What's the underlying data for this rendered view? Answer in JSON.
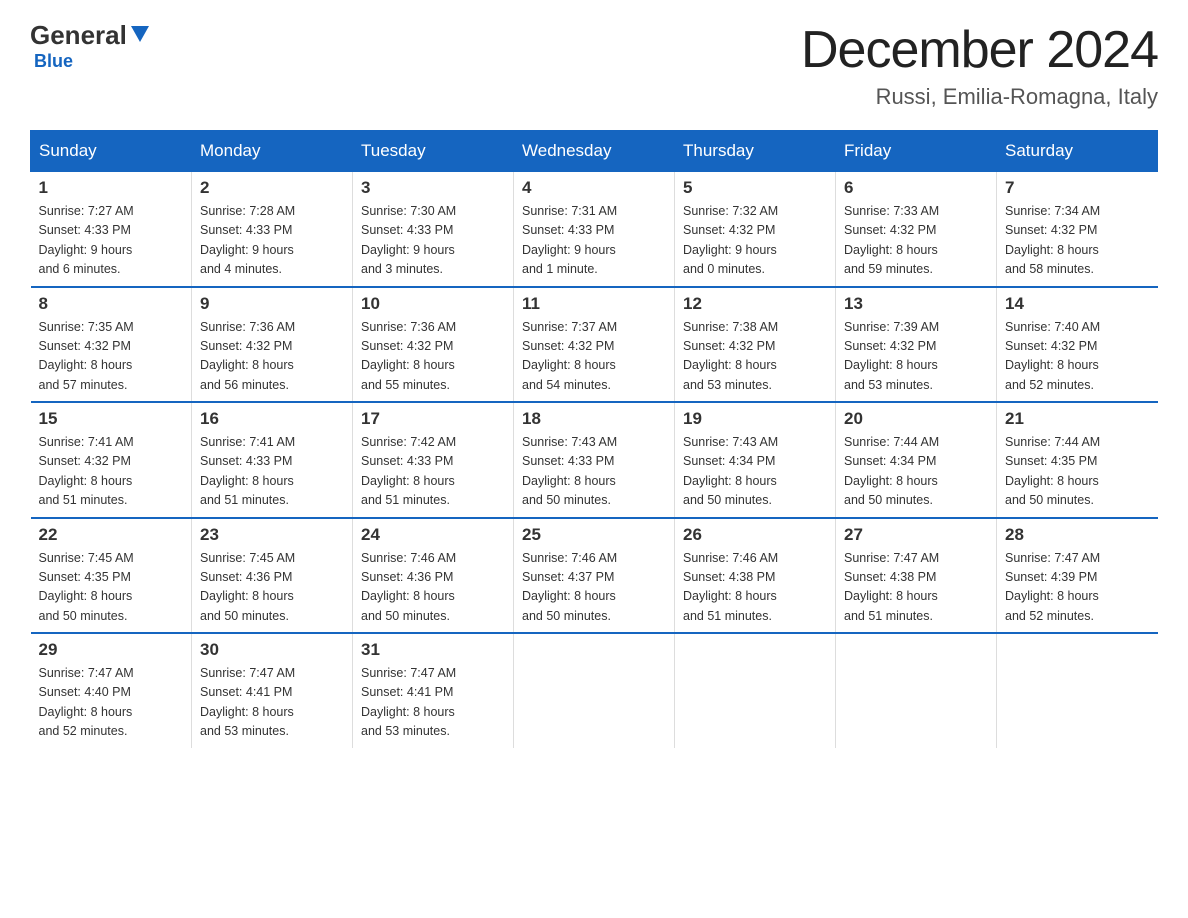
{
  "logo": {
    "general": "General",
    "blue": "Blue"
  },
  "title": "December 2024",
  "subtitle": "Russi, Emilia-Romagna, Italy",
  "days_header": [
    "Sunday",
    "Monday",
    "Tuesday",
    "Wednesday",
    "Thursday",
    "Friday",
    "Saturday"
  ],
  "weeks": [
    [
      {
        "day": "1",
        "sunrise": "7:27 AM",
        "sunset": "4:33 PM",
        "daylight": "9 hours and 6 minutes."
      },
      {
        "day": "2",
        "sunrise": "7:28 AM",
        "sunset": "4:33 PM",
        "daylight": "9 hours and 4 minutes."
      },
      {
        "day": "3",
        "sunrise": "7:30 AM",
        "sunset": "4:33 PM",
        "daylight": "9 hours and 3 minutes."
      },
      {
        "day": "4",
        "sunrise": "7:31 AM",
        "sunset": "4:33 PM",
        "daylight": "9 hours and 1 minute."
      },
      {
        "day": "5",
        "sunrise": "7:32 AM",
        "sunset": "4:32 PM",
        "daylight": "9 hours and 0 minutes."
      },
      {
        "day": "6",
        "sunrise": "7:33 AM",
        "sunset": "4:32 PM",
        "daylight": "8 hours and 59 minutes."
      },
      {
        "day": "7",
        "sunrise": "7:34 AM",
        "sunset": "4:32 PM",
        "daylight": "8 hours and 58 minutes."
      }
    ],
    [
      {
        "day": "8",
        "sunrise": "7:35 AM",
        "sunset": "4:32 PM",
        "daylight": "8 hours and 57 minutes."
      },
      {
        "day": "9",
        "sunrise": "7:36 AM",
        "sunset": "4:32 PM",
        "daylight": "8 hours and 56 minutes."
      },
      {
        "day": "10",
        "sunrise": "7:36 AM",
        "sunset": "4:32 PM",
        "daylight": "8 hours and 55 minutes."
      },
      {
        "day": "11",
        "sunrise": "7:37 AM",
        "sunset": "4:32 PM",
        "daylight": "8 hours and 54 minutes."
      },
      {
        "day": "12",
        "sunrise": "7:38 AM",
        "sunset": "4:32 PM",
        "daylight": "8 hours and 53 minutes."
      },
      {
        "day": "13",
        "sunrise": "7:39 AM",
        "sunset": "4:32 PM",
        "daylight": "8 hours and 53 minutes."
      },
      {
        "day": "14",
        "sunrise": "7:40 AM",
        "sunset": "4:32 PM",
        "daylight": "8 hours and 52 minutes."
      }
    ],
    [
      {
        "day": "15",
        "sunrise": "7:41 AM",
        "sunset": "4:32 PM",
        "daylight": "8 hours and 51 minutes."
      },
      {
        "day": "16",
        "sunrise": "7:41 AM",
        "sunset": "4:33 PM",
        "daylight": "8 hours and 51 minutes."
      },
      {
        "day": "17",
        "sunrise": "7:42 AM",
        "sunset": "4:33 PM",
        "daylight": "8 hours and 51 minutes."
      },
      {
        "day": "18",
        "sunrise": "7:43 AM",
        "sunset": "4:33 PM",
        "daylight": "8 hours and 50 minutes."
      },
      {
        "day": "19",
        "sunrise": "7:43 AM",
        "sunset": "4:34 PM",
        "daylight": "8 hours and 50 minutes."
      },
      {
        "day": "20",
        "sunrise": "7:44 AM",
        "sunset": "4:34 PM",
        "daylight": "8 hours and 50 minutes."
      },
      {
        "day": "21",
        "sunrise": "7:44 AM",
        "sunset": "4:35 PM",
        "daylight": "8 hours and 50 minutes."
      }
    ],
    [
      {
        "day": "22",
        "sunrise": "7:45 AM",
        "sunset": "4:35 PM",
        "daylight": "8 hours and 50 minutes."
      },
      {
        "day": "23",
        "sunrise": "7:45 AM",
        "sunset": "4:36 PM",
        "daylight": "8 hours and 50 minutes."
      },
      {
        "day": "24",
        "sunrise": "7:46 AM",
        "sunset": "4:36 PM",
        "daylight": "8 hours and 50 minutes."
      },
      {
        "day": "25",
        "sunrise": "7:46 AM",
        "sunset": "4:37 PM",
        "daylight": "8 hours and 50 minutes."
      },
      {
        "day": "26",
        "sunrise": "7:46 AM",
        "sunset": "4:38 PM",
        "daylight": "8 hours and 51 minutes."
      },
      {
        "day": "27",
        "sunrise": "7:47 AM",
        "sunset": "4:38 PM",
        "daylight": "8 hours and 51 minutes."
      },
      {
        "day": "28",
        "sunrise": "7:47 AM",
        "sunset": "4:39 PM",
        "daylight": "8 hours and 52 minutes."
      }
    ],
    [
      {
        "day": "29",
        "sunrise": "7:47 AM",
        "sunset": "4:40 PM",
        "daylight": "8 hours and 52 minutes."
      },
      {
        "day": "30",
        "sunrise": "7:47 AM",
        "sunset": "4:41 PM",
        "daylight": "8 hours and 53 minutes."
      },
      {
        "day": "31",
        "sunrise": "7:47 AM",
        "sunset": "4:41 PM",
        "daylight": "8 hours and 53 minutes."
      },
      null,
      null,
      null,
      null
    ]
  ],
  "labels": {
    "sunrise": "Sunrise:",
    "sunset": "Sunset:",
    "daylight": "Daylight:"
  },
  "accent_color": "#1565c0"
}
